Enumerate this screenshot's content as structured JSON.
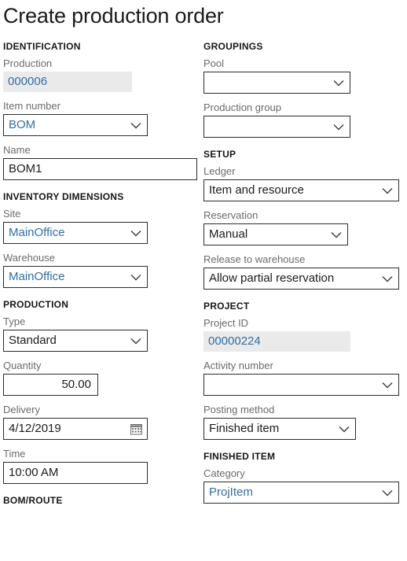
{
  "page": {
    "title": "Create production order"
  },
  "left": {
    "identification": {
      "header": "IDENTIFICATION",
      "production": {
        "label": "Production",
        "value": "000006"
      },
      "item_number": {
        "label": "Item number",
        "value": "BOM"
      },
      "name": {
        "label": "Name",
        "value": "BOM1"
      }
    },
    "inventory_dimensions": {
      "header": "INVENTORY DIMENSIONS",
      "site": {
        "label": "Site",
        "value": "MainOffice"
      },
      "warehouse": {
        "label": "Warehouse",
        "value": "MainOffice"
      }
    },
    "production": {
      "header": "PRODUCTION",
      "type": {
        "label": "Type",
        "value": "Standard"
      },
      "quantity": {
        "label": "Quantity",
        "value": "50.00"
      },
      "delivery": {
        "label": "Delivery",
        "value": "4/12/2019"
      },
      "time": {
        "label": "Time",
        "value": "10:00 AM"
      }
    },
    "bom_route": {
      "header": "BOM/ROUTE"
    }
  },
  "right": {
    "groupings": {
      "header": "GROUPINGS",
      "pool": {
        "label": "Pool",
        "value": ""
      },
      "production_group": {
        "label": "Production group",
        "value": ""
      }
    },
    "setup": {
      "header": "SETUP",
      "ledger": {
        "label": "Ledger",
        "value": "Item and resource"
      },
      "reservation": {
        "label": "Reservation",
        "value": "Manual"
      },
      "release_to_warehouse": {
        "label": "Release to warehouse",
        "value": "Allow partial reservation"
      }
    },
    "project": {
      "header": "PROJECT",
      "project_id": {
        "label": "Project ID",
        "value": "00000224"
      },
      "activity_number": {
        "label": "Activity number",
        "value": ""
      },
      "posting_method": {
        "label": "Posting method",
        "value": "Finished item"
      }
    },
    "finished_item": {
      "header": "FINISHED ITEM",
      "category": {
        "label": "Category",
        "value": "ProjItem"
      }
    }
  },
  "icons": {
    "chevron": "chevron-down-icon",
    "calendar": "calendar-icon"
  },
  "colors": {
    "link_blue": "#2f6fa7",
    "label_gray": "#6b6b6b",
    "readonly_bg": "#eaeaea",
    "border": "#2b2b2b",
    "text": "#1b1b1b"
  }
}
